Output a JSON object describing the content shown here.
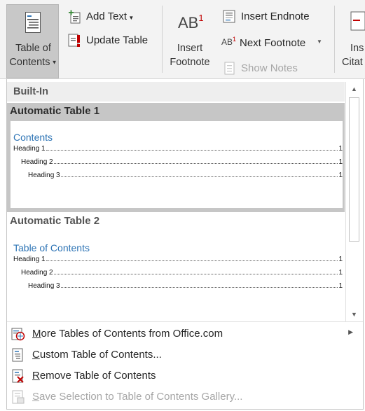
{
  "ribbon": {
    "toc_button": {
      "line1": "Table of",
      "line2": "Contents"
    },
    "add_text": "Add Text",
    "update_table": "Update Table",
    "insert_footnote": {
      "line1": "Insert",
      "line2": "Footnote"
    },
    "insert_endnote": "Insert Endnote",
    "next_footnote": "Next Footnote",
    "show_notes": "Show Notes",
    "insert_citation": {
      "line1": "Ins",
      "line2": "Citat"
    }
  },
  "gallery": {
    "section_header": "Built-In",
    "items": [
      {
        "title": "Automatic Table 1",
        "preview_heading": "Contents",
        "lines": [
          {
            "text": "Heading 1",
            "page": "1"
          },
          {
            "text": "Heading 2",
            "page": "1"
          },
          {
            "text": "Heading 3",
            "page": "1"
          }
        ]
      },
      {
        "title": "Automatic Table 2",
        "preview_heading": "Table of Contents",
        "lines": [
          {
            "text": "Heading 1",
            "page": "1"
          },
          {
            "text": "Heading 2",
            "page": "1"
          },
          {
            "text": "Heading 3",
            "page": "1"
          }
        ]
      }
    ]
  },
  "menu": {
    "more_tables": {
      "first": "M",
      "rest": "ore Tables of Contents from Office.com"
    },
    "custom_table": {
      "first": "C",
      "rest": "ustom Table of Contents..."
    },
    "remove_table": {
      "first": "R",
      "rest": "emove Table of Contents"
    },
    "save_selection": {
      "first": "S",
      "rest": "ave Selection to Table of Contents Gallery..."
    }
  },
  "colors": {
    "accent_blue": "#2e74b5",
    "footnote_red": "#c00000",
    "selected_item_bg": "#c6c6c6"
  }
}
